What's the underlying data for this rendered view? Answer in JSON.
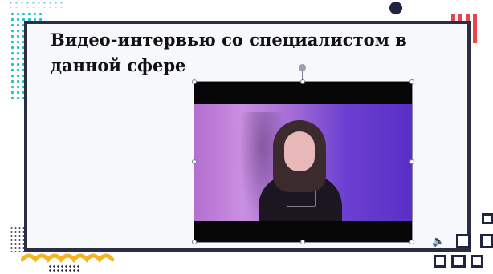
{
  "slide": {
    "title": "Видео-интервью со специалистом в данной сфере"
  },
  "video": {
    "selected": true
  },
  "icons": {
    "audio": "speaker-icon",
    "rotate": "rotate-handle-icon"
  },
  "colors": {
    "frame": "#2b2d42",
    "accent_red": "#e8464d",
    "accent_cyan": "#19c2c9",
    "accent_yellow": "#f3b61f",
    "speaker": "#c89a1d"
  }
}
